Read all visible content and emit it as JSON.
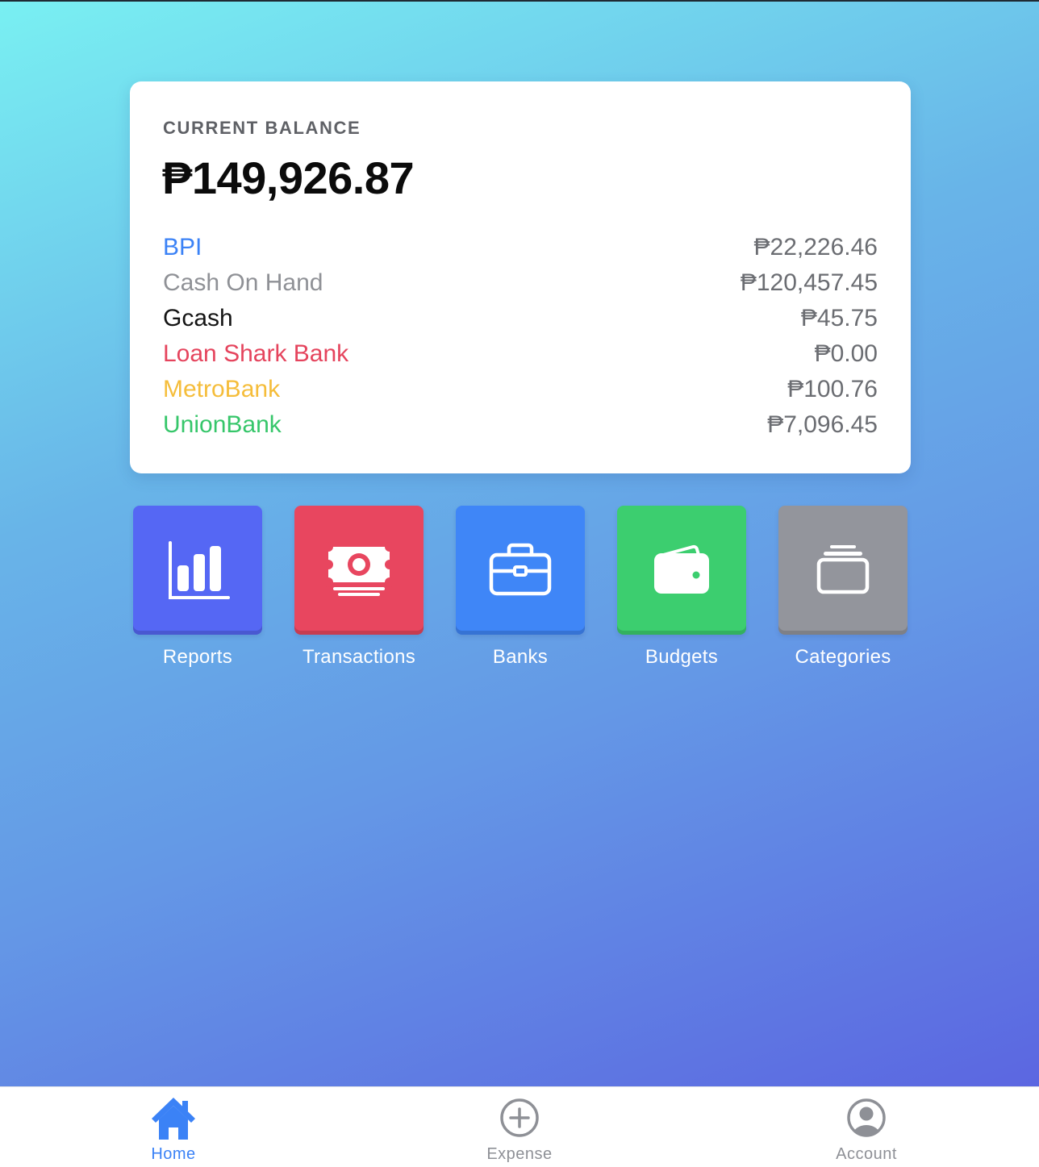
{
  "balance": {
    "label": "CURRENT BALANCE",
    "total": "₱149,926.87"
  },
  "banks": [
    {
      "name": "BPI",
      "amount": "₱22,226.46",
      "color": "#3b82f6"
    },
    {
      "name": "Cash On Hand",
      "amount": "₱120,457.45",
      "color": "#8f9196"
    },
    {
      "name": "Gcash",
      "amount": "₱45.75",
      "color": "#141414"
    },
    {
      "name": "Loan Shark Bank",
      "amount": "₱0.00",
      "color": "#e5445d"
    },
    {
      "name": "MetroBank",
      "amount": "₱100.76",
      "color": "#f5bd3a"
    },
    {
      "name": "UnionBank",
      "amount": "₱7,096.45",
      "color": "#36c66a"
    }
  ],
  "shortcuts": [
    {
      "label": "Reports",
      "icon": "bar-chart-icon",
      "color": "#5567f4"
    },
    {
      "label": "Transactions",
      "icon": "money-bill-icon",
      "color": "#e8465f"
    },
    {
      "label": "Banks",
      "icon": "briefcase-icon",
      "color": "#3f86f7"
    },
    {
      "label": "Budgets",
      "icon": "wallet-icon",
      "color": "#3cce6f"
    },
    {
      "label": "Categories",
      "icon": "card-stack-icon",
      "color": "#93959c"
    }
  ],
  "tabbar": {
    "active_color": "#3b82f6",
    "inactive_color": "#8e9096",
    "tabs": [
      {
        "label": "Home",
        "icon": "home-icon",
        "active": true
      },
      {
        "label": "Expense",
        "icon": "plus-circle-icon",
        "active": false
      },
      {
        "label": "Account",
        "icon": "user-circle-icon",
        "active": false
      }
    ]
  }
}
